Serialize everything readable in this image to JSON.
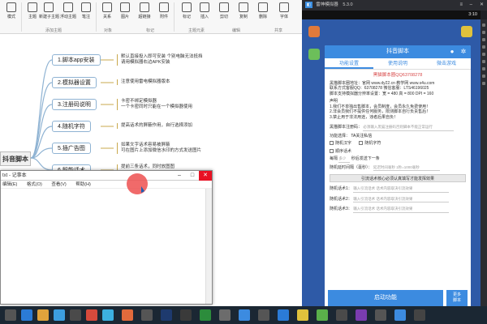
{
  "ribbon": {
    "buttons": [
      "模式",
      "主题",
      "新建子主题",
      "浮动主题",
      "笔注",
      "关系",
      "图片",
      "超链接",
      "附件",
      "标记",
      "插入",
      "剪切",
      "复制",
      "删除",
      "字体"
    ],
    "groups": [
      "添加主题",
      "对象",
      "标记",
      "主题元素",
      "编辑",
      "共享"
    ]
  },
  "mindmap": {
    "root": "抖音脚本",
    "nodes": [
      {
        "label": "1.脚本app安装",
        "note": [
          "默认直接投入即可安装 个别电脑无法抵挡",
          "请用模拟器右边APK安装"
        ]
      },
      {
        "label": "2.模拟器设置",
        "note": [
          "注意使用雷电模拟器版本"
        ]
      },
      {
        "label": "3.注册码说明",
        "note": [
          "卡密不绑定模拟器",
          "一个卡密同时只能在一个模拟器使用"
        ]
      },
      {
        "label": "4.随机字符",
        "note": [
          "提高话术的屏蔽作用，自行选择添加"
        ]
      },
      {
        "label": "5.插广告图",
        "note": [
          "如果文字话术容易被屏蔽",
          "可在图片上添加微信水印的方式发送图片"
        ]
      },
      {
        "label": "6.智能话术",
        "note": [
          "提前三条话术，同时放图图"
        ]
      }
    ]
  },
  "notepad": {
    "title": "txt - 记事本",
    "menu": [
      "编辑(E)",
      "格式(O)",
      "查看(V)",
      "帮助(H)"
    ]
  },
  "emulator": {
    "title": "雷神模拟器",
    "version": "5.3.0",
    "time": "3:10",
    "app": {
      "header": "抖音脚本",
      "tabs": [
        "功能设置",
        "使用说明",
        "微击游戏"
      ],
      "red_title": "黑猫脚本圈QQ63708278",
      "info": [
        "黑猫脚本圈地址：官网 www.dy22.cn 教学网 www.s4u.com",
        "联系方式客服QQ：63708278  微信客服：LTS46196025",
        "脚本支持模拟器分辨率设置：宽 = 480 高 = 800 DPI = 160"
      ],
      "declaration_title": "声明",
      "declaration": [
        "1.我们不单独出售脚本，会员制度，会员永久免费使用！",
        "2.非会员我们不提供任何服务，限测脚本自行负责售后！",
        "3.禁止用于非法用途，违者后果自负！"
      ],
      "reg_label": "黑猫脚本注册码：",
      "reg_placeholder": "必须输入黑猫注册码否则脚本不能正常运行",
      "mode_label": "功能选择：",
      "mode_value": "TA关注私信",
      "options": [
        "随机汉字",
        "随机字符",
        "顺序话术"
      ],
      "per_sec_label": "每隔",
      "per_sec_value": "多少",
      "per_sec_tail": "秒后发送下一条",
      "delay_label": "随机延时间隔（毫秒）：",
      "delay_value": "延迟时间毫秒  1秒=1000毫秒",
      "wide_btn": "引流话术核心必须认真填写才能发挥效果",
      "phrases": [
        {
          "label": "随机话术1：",
          "hint": "输入引流话术  话术内容取决引流效果"
        },
        {
          "label": "随机话术2：",
          "hint": "输入引流话术  话术内容取决引流效果"
        },
        {
          "label": "随机话术3：",
          "hint": "输入引流话术  话术内容取决引流效果"
        }
      ],
      "start_btn": "启动功能",
      "more_btn": [
        "更多",
        "脚本"
      ]
    }
  },
  "colors": {
    "accent": "#3c8be0",
    "red": "#d84a4a",
    "desktop": "#3b8fc9"
  }
}
